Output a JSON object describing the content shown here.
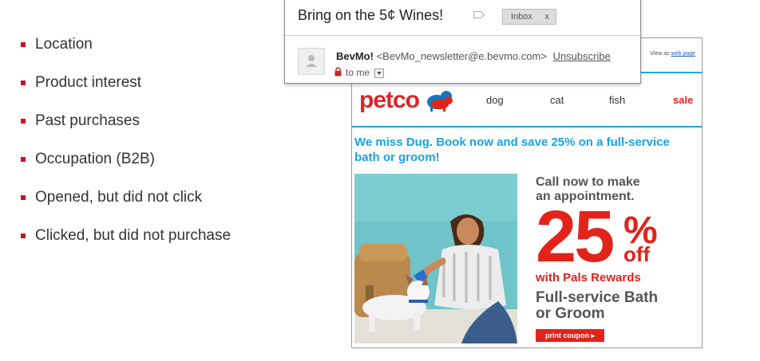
{
  "bullets": [
    "Location",
    "Product interest",
    "Past purchases",
    "Occupation (B2B)",
    "Opened, but did not click",
    "Clicked, but did not purchase"
  ],
  "gmail": {
    "subject": "Bring on the 5¢ Wines!",
    "label": "Inbox",
    "label_close": "x",
    "sender_name": "BevMo!",
    "sender_address": "<BevMo_newsletter@e.bevmo.com>",
    "unsubscribe": "Unsubscribe",
    "to_me": "to me"
  },
  "petco": {
    "view_prefix": "View as ",
    "view_link": "web page",
    "logo": "petco",
    "nav": [
      "dog",
      "cat",
      "fish",
      "sale"
    ],
    "headline": "We miss Dug. Book now and save 25% on a full-service bath or groom!",
    "call_line1": "Call now to make",
    "call_line2": "an appointment.",
    "discount_number": "25",
    "discount_percent": "%",
    "discount_off": "off",
    "pals": "with Pals Rewards",
    "service_line1": "Full-service Bath",
    "service_line2": "or Groom",
    "coupon": "print coupon ▸"
  },
  "colors": {
    "bullet_red": "#c8102e",
    "petco_red": "#e2231a",
    "petco_blue": "#1ba1e2"
  }
}
